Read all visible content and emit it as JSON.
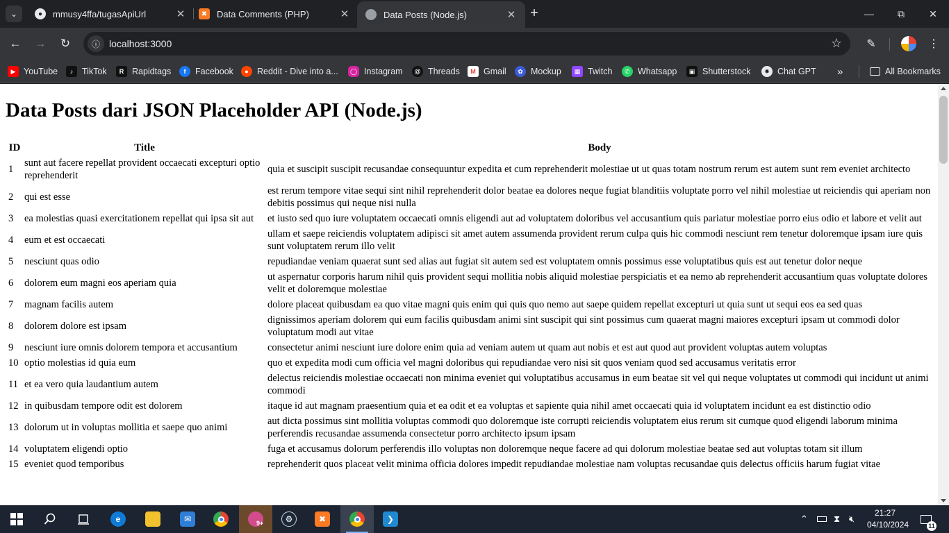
{
  "tabs": [
    {
      "title": "mmusy4ffa/tugasApiUrl",
      "favicon": "github-icon",
      "active": false
    },
    {
      "title": "Data Comments (PHP)",
      "favicon": "xampp-icon",
      "active": false
    },
    {
      "title": "Data Posts (Node.js)",
      "favicon": "globe-icon",
      "active": true
    }
  ],
  "toolbar": {
    "url": "localhost:3000"
  },
  "bookmarks": [
    {
      "label": "YouTube",
      "icon": "youtube-icon",
      "color": "#ff0000"
    },
    {
      "label": "TikTok",
      "icon": "tiktok-icon",
      "color": "#111111"
    },
    {
      "label": "Rapidtags",
      "icon": "rapidtags-icon",
      "color": "#111111"
    },
    {
      "label": "Facebook",
      "icon": "facebook-icon",
      "color": "#1877f2"
    },
    {
      "label": "Reddit - Dive into a...",
      "icon": "reddit-icon",
      "color": "#ff4500"
    },
    {
      "label": "Instagram",
      "icon": "instagram-icon",
      "color": "#d6249f"
    },
    {
      "label": "Threads",
      "icon": "threads-icon",
      "color": "#111111"
    },
    {
      "label": "Gmail",
      "icon": "gmail-icon",
      "color": "#ea4335"
    },
    {
      "label": "Mockup",
      "icon": "mockup-icon",
      "color": "#3b5bdb"
    },
    {
      "label": "Twitch",
      "icon": "twitch-icon",
      "color": "#9146ff"
    },
    {
      "label": "Whatsapp",
      "icon": "whatsapp-icon",
      "color": "#25d366"
    },
    {
      "label": "Shutterstock",
      "icon": "shutterstock-icon",
      "color": "#111111"
    },
    {
      "label": "Chat GPT",
      "icon": "chatgpt-icon",
      "color": "#e8eaed"
    }
  ],
  "all_bookmarks_label": "All Bookmarks",
  "page": {
    "heading": "Data Posts dari JSON Placeholder API (Node.js)",
    "columns": [
      "ID",
      "Title",
      "Body"
    ],
    "rows": [
      {
        "id": "1",
        "title": "sunt aut facere repellat provident occaecati excepturi optio reprehenderit",
        "body": "quia et suscipit suscipit recusandae consequuntur expedita et cum reprehenderit molestiae ut ut quas totam nostrum rerum est autem sunt rem eveniet architecto"
      },
      {
        "id": "2",
        "title": "qui est esse",
        "body": "est rerum tempore vitae sequi sint nihil reprehenderit dolor beatae ea dolores neque fugiat blanditiis voluptate porro vel nihil molestiae ut reiciendis qui aperiam non debitis possimus qui neque nisi nulla"
      },
      {
        "id": "3",
        "title": "ea molestias quasi exercitationem repellat qui ipsa sit aut",
        "body": "et iusto sed quo iure voluptatem occaecati omnis eligendi aut ad voluptatem doloribus vel accusantium quis pariatur molestiae porro eius odio et labore et velit aut"
      },
      {
        "id": "4",
        "title": "eum et est occaecati",
        "body": "ullam et saepe reiciendis voluptatem adipisci sit amet autem assumenda provident rerum culpa quis hic commodi nesciunt rem tenetur doloremque ipsam iure quis sunt voluptatem rerum illo velit"
      },
      {
        "id": "5",
        "title": "nesciunt quas odio",
        "body": "repudiandae veniam quaerat sunt sed alias aut fugiat sit autem sed est voluptatem omnis possimus esse voluptatibus quis est aut tenetur dolor neque"
      },
      {
        "id": "6",
        "title": "dolorem eum magni eos aperiam quia",
        "body": "ut aspernatur corporis harum nihil quis provident sequi mollitia nobis aliquid molestiae perspiciatis et ea nemo ab reprehenderit accusantium quas voluptate dolores velit et doloremque molestiae"
      },
      {
        "id": "7",
        "title": "magnam facilis autem",
        "body": "dolore placeat quibusdam ea quo vitae magni quis enim qui quis quo nemo aut saepe quidem repellat excepturi ut quia sunt ut sequi eos ea sed quas"
      },
      {
        "id": "8",
        "title": "dolorem dolore est ipsam",
        "body": "dignissimos aperiam dolorem qui eum facilis quibusdam animi sint suscipit qui sint possimus cum quaerat magni maiores excepturi ipsam ut commodi dolor voluptatum modi aut vitae"
      },
      {
        "id": "9",
        "title": "nesciunt iure omnis dolorem tempora et accusantium",
        "body": "consectetur animi nesciunt iure dolore enim quia ad veniam autem ut quam aut nobis et est aut quod aut provident voluptas autem voluptas"
      },
      {
        "id": "10",
        "title": "optio molestias id quia eum",
        "body": "quo et expedita modi cum officia vel magni doloribus qui repudiandae vero nisi sit quos veniam quod sed accusamus veritatis error"
      },
      {
        "id": "11",
        "title": "et ea vero quia laudantium autem",
        "body": "delectus reiciendis molestiae occaecati non minima eveniet qui voluptatibus accusamus in eum beatae sit vel qui neque voluptates ut commodi qui incidunt ut animi commodi"
      },
      {
        "id": "12",
        "title": "in quibusdam tempore odit est dolorem",
        "body": "itaque id aut magnam praesentium quia et ea odit et ea voluptas et sapiente quia nihil amet occaecati quia id voluptatem incidunt ea est distinctio odio"
      },
      {
        "id": "13",
        "title": "dolorum ut in voluptas mollitia et saepe quo animi",
        "body": "aut dicta possimus sint mollitia voluptas commodi quo doloremque iste corrupti reiciendis voluptatem eius rerum sit cumque quod eligendi laborum minima perferendis recusandae assumenda consectetur porro architecto ipsum ipsam"
      },
      {
        "id": "14",
        "title": "voluptatem eligendi optio",
        "body": "fuga et accusamus dolorum perferendis illo voluptas non doloremque neque facere ad qui dolorum molestiae beatae sed aut voluptas totam sit illum"
      },
      {
        "id": "15",
        "title": "eveniet quod temporibus",
        "body": "reprehenderit quos placeat velit minima officia dolores impedit repudiandae molestiae nam voluptas recusandae quis delectus officiis harum fugiat vitae"
      }
    ]
  },
  "taskbar": {
    "time": "21:27",
    "date": "04/10/2024",
    "notification_count": "11",
    "badge_count": "9+"
  }
}
